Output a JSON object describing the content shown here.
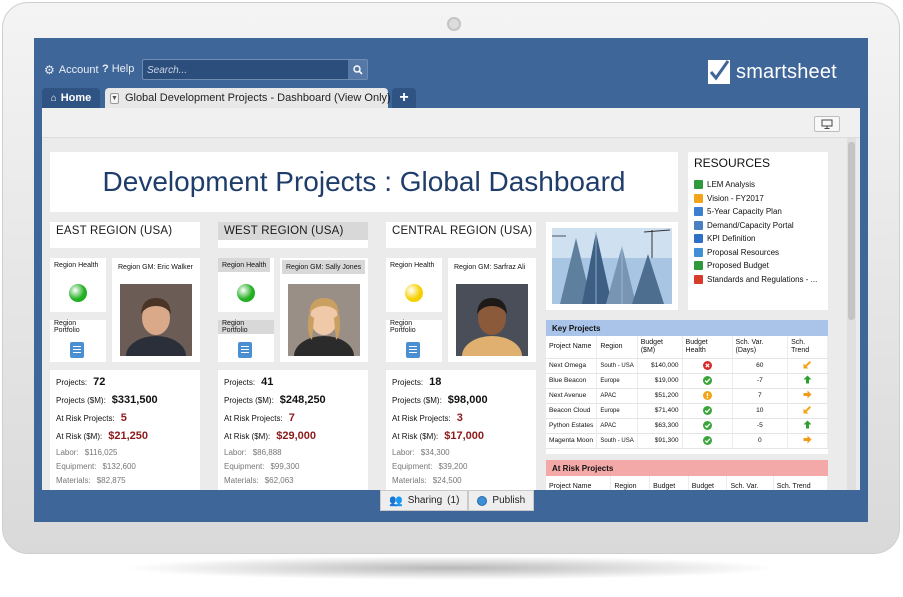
{
  "topbar": {
    "account_label": "Account",
    "help_label": "Help",
    "search_placeholder": "Search...",
    "logo_text": "smartsheet"
  },
  "tabs": {
    "home_label": "Home",
    "doc_label": "Global Development Projects - Dashboard (View Only)",
    "close_glyph": "×",
    "add_glyph": "+"
  },
  "dashboard": {
    "title": "Development Projects : Global Dashboard",
    "resources": {
      "heading": "RESOURCES",
      "items": [
        {
          "label": "LEM Analysis",
          "icon": "spreadsheet-icon",
          "color": "#2e9a3c"
        },
        {
          "label": "Vision - FY2017",
          "icon": "slides-icon",
          "color": "#f2a51a"
        },
        {
          "label": "5-Year Capacity Plan",
          "icon": "document-icon",
          "color": "#3a7fd0"
        },
        {
          "label": "Demand/Capacity Portal",
          "icon": "link-icon",
          "color": "#4a7fc0"
        },
        {
          "label": "KPI Definition",
          "icon": "word-icon",
          "color": "#2f6fc5"
        },
        {
          "label": "Proposal Resources",
          "icon": "folder-icon",
          "color": "#3f8fd6"
        },
        {
          "label": "Proposed Budget",
          "icon": "excel-icon",
          "color": "#2e9a3c"
        },
        {
          "label": "Standards and Regulations - ...",
          "icon": "pdf-icon",
          "color": "#d83b2b"
        }
      ]
    },
    "regions": [
      {
        "name": "EAST REGION (USA)",
        "health_label": "Region Health",
        "health_color": "#22b022",
        "gm_label": "Region GM: Eric Walker",
        "portfolio_label": "Region Portfolio",
        "projects_label": "Projects:",
        "projects": "72",
        "projects_m_label": "Projects ($M):",
        "projects_m": "$331,500",
        "at_risk_label": "At Risk Projects:",
        "at_risk": "5",
        "at_risk_m_label": "At Risk ($M):",
        "at_risk_m": "$21,250",
        "labor_label": "Labor:",
        "labor": "$116,025",
        "equipment_label": "Equipment:",
        "equipment": "$132,600",
        "materials_label": "Materials:",
        "materials": "$82,875"
      },
      {
        "name": "WEST REGION (USA)",
        "health_label": "Region Health",
        "health_color": "#22b022",
        "gm_label": "Region GM: Sally Jones",
        "portfolio_label": "Region Portfolio",
        "projects_label": "Projects:",
        "projects": "41",
        "projects_m_label": "Projects ($M):",
        "projects_m": "$248,250",
        "at_risk_label": "At Risk Projects:",
        "at_risk": "7",
        "at_risk_m_label": "At Risk ($M):",
        "at_risk_m": "$29,000",
        "labor_label": "Labor:",
        "labor": "$86,888",
        "equipment_label": "Equipment:",
        "equipment": "$99,300",
        "materials_label": "Materials:",
        "materials": "$62,063"
      },
      {
        "name": "CENTRAL REGION (USA)",
        "health_label": "Region Health",
        "health_color": "#f5d000",
        "gm_label": "Region GM: Sarfraz Ali",
        "portfolio_label": "Region Portfolio",
        "projects_label": "Projects:",
        "projects": "18",
        "projects_m_label": "Projects ($M):",
        "projects_m": "$98,000",
        "at_risk_label": "At Risk Projects:",
        "at_risk": "3",
        "at_risk_m_label": "At Risk ($M):",
        "at_risk_m": "$17,000",
        "labor_label": "Labor:",
        "labor": "$34,300",
        "equipment_label": "Equipment:",
        "equipment": "$39,200",
        "materials_label": "Materials:",
        "materials": "$24,500"
      }
    ],
    "key_projects": {
      "heading": "Key Projects",
      "columns": [
        "Project Name",
        "Region",
        "Budget ($M)",
        "Budget Health",
        "Sch. Var. (Days)",
        "Sch. Trend"
      ],
      "rows": [
        {
          "name": "Next Omega",
          "region": "South - USA",
          "budget": "$140,000",
          "health": "red",
          "var": "60",
          "trend": "down-left"
        },
        {
          "name": "Blue Beacon",
          "region": "Europe",
          "budget": "$19,000",
          "health": "green",
          "var": "-7",
          "trend": "up"
        },
        {
          "name": "Next Avenue",
          "region": "APAC",
          "budget": "$51,200",
          "health": "yellow",
          "var": "7",
          "trend": "right"
        },
        {
          "name": "Beacon Cloud",
          "region": "Europe",
          "budget": "$71,400",
          "health": "green",
          "var": "10",
          "trend": "down-left"
        },
        {
          "name": "Python Estates",
          "region": "APAC",
          "budget": "$63,300",
          "health": "green",
          "var": "-5",
          "trend": "up"
        },
        {
          "name": "Magenta Moon",
          "region": "South - USA",
          "budget": "$91,300",
          "health": "green",
          "var": "0",
          "trend": "right"
        }
      ]
    },
    "at_risk_projects": {
      "heading": "At Risk Projects",
      "columns": [
        "Project Name",
        "Region",
        "Budget",
        "Budget",
        "Sch. Var.",
        "Sch. Trend"
      ]
    }
  },
  "bottombar": {
    "sharing_label": "Sharing",
    "sharing_count": "(1)",
    "publish_label": "Publish"
  },
  "colors": {
    "frame_blue": "#3f6699",
    "title_blue": "#1f3d6b",
    "risk_red": "#8b1a1a",
    "key_header": "#a9c4e8",
    "risk_header": "#f4a9a9"
  }
}
